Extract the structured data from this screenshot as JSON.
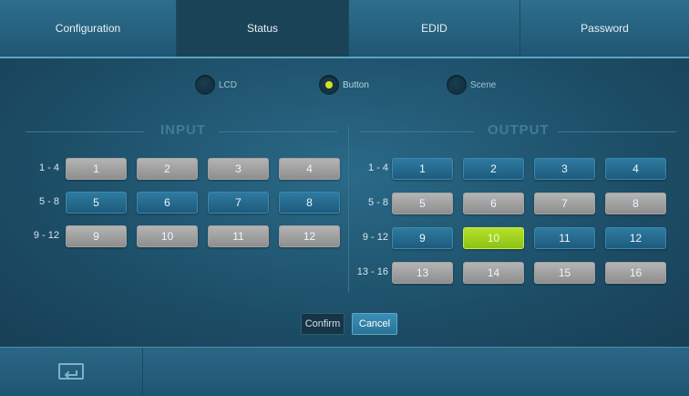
{
  "tabs": [
    {
      "label": "Configuration",
      "active": false
    },
    {
      "label": "Status",
      "active": true
    },
    {
      "label": "EDID",
      "active": false
    },
    {
      "label": "Password",
      "active": false
    }
  ],
  "modes": [
    {
      "label": "LCD",
      "selected": false
    },
    {
      "label": "Button",
      "selected": true
    },
    {
      "label": "Scene",
      "selected": false
    }
  ],
  "input": {
    "title": "INPUT",
    "rows": [
      {
        "label": "1 - 4",
        "cells": [
          {
            "n": "1",
            "state": "gray"
          },
          {
            "n": "2",
            "state": "gray"
          },
          {
            "n": "3",
            "state": "gray"
          },
          {
            "n": "4",
            "state": "gray"
          }
        ]
      },
      {
        "label": "5 - 8",
        "cells": [
          {
            "n": "5",
            "state": "blue"
          },
          {
            "n": "6",
            "state": "blue"
          },
          {
            "n": "7",
            "state": "blue"
          },
          {
            "n": "8",
            "state": "blue"
          }
        ]
      },
      {
        "label": "9 - 12",
        "cells": [
          {
            "n": "9",
            "state": "gray"
          },
          {
            "n": "10",
            "state": "gray"
          },
          {
            "n": "11",
            "state": "gray"
          },
          {
            "n": "12",
            "state": "gray"
          }
        ]
      }
    ]
  },
  "output": {
    "title": "OUTPUT",
    "rows": [
      {
        "label": "1 - 4",
        "cells": [
          {
            "n": "1",
            "state": "blue"
          },
          {
            "n": "2",
            "state": "blue"
          },
          {
            "n": "3",
            "state": "blue"
          },
          {
            "n": "4",
            "state": "blue"
          }
        ]
      },
      {
        "label": "5 - 8",
        "cells": [
          {
            "n": "5",
            "state": "gray"
          },
          {
            "n": "6",
            "state": "gray"
          },
          {
            "n": "7",
            "state": "gray"
          },
          {
            "n": "8",
            "state": "gray"
          }
        ]
      },
      {
        "label": "9 - 12",
        "cells": [
          {
            "n": "9",
            "state": "blue"
          },
          {
            "n": "10",
            "state": "green"
          },
          {
            "n": "11",
            "state": "blue"
          },
          {
            "n": "12",
            "state": "blue"
          }
        ]
      },
      {
        "label": "13 - 16",
        "cells": [
          {
            "n": "13",
            "state": "gray"
          },
          {
            "n": "14",
            "state": "gray"
          },
          {
            "n": "15",
            "state": "gray"
          },
          {
            "n": "16",
            "state": "gray"
          }
        ]
      }
    ]
  },
  "actions": {
    "confirm": "Confirm",
    "cancel": "Cancel"
  },
  "bottom": {
    "back_icon": "return-icon"
  },
  "colors": {
    "selected": "#8cc314",
    "active_blue": "#1e5b7d",
    "inactive_gray": "#8e8e8e",
    "radio_dot": "#d9e21d"
  }
}
